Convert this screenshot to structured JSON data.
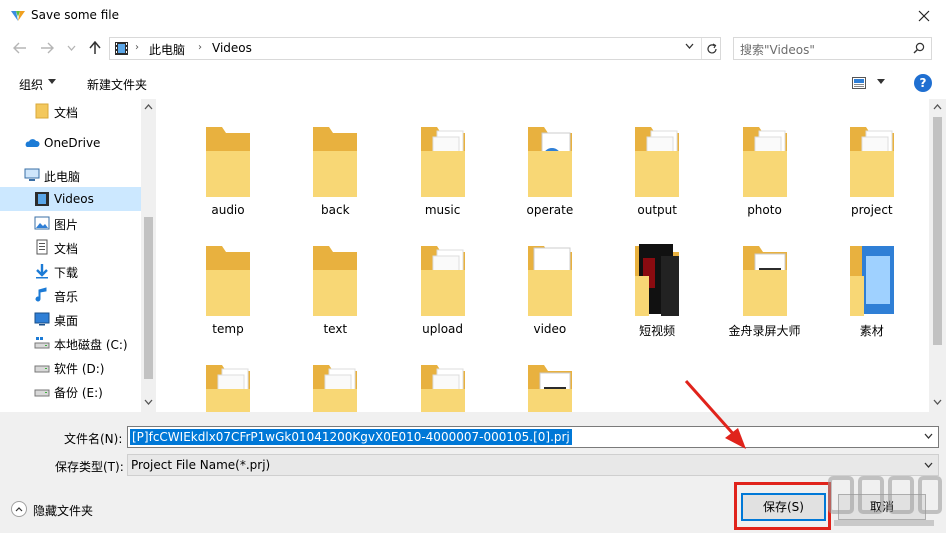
{
  "window": {
    "title": "Save some file"
  },
  "address": {
    "crumbs": [
      "此电脑",
      "Videos"
    ],
    "search_placeholder": "搜索\"Videos\""
  },
  "toolbar": {
    "organize": "组织",
    "new_folder": "新建文件夹",
    "help": "?"
  },
  "nav": {
    "items": [
      {
        "label": "文档",
        "icon": "folder-icon"
      },
      {
        "label": "OneDrive",
        "icon": "cloud-icon"
      },
      {
        "label": "此电脑",
        "icon": "computer-icon"
      },
      {
        "label": "Videos",
        "icon": "video-folder-icon",
        "selected": true
      },
      {
        "label": "图片",
        "icon": "pictures-icon"
      },
      {
        "label": "文档",
        "icon": "documents-icon"
      },
      {
        "label": "下载",
        "icon": "download-icon"
      },
      {
        "label": "音乐",
        "icon": "music-icon"
      },
      {
        "label": "桌面",
        "icon": "desktop-icon"
      },
      {
        "label": "本地磁盘 (C:)",
        "icon": "drive-c-icon"
      },
      {
        "label": "软件 (D:)",
        "icon": "drive-icon"
      },
      {
        "label": "备份 (E:)",
        "icon": "drive-icon"
      }
    ]
  },
  "files": [
    {
      "name": "audio",
      "kind": "empty"
    },
    {
      "name": "back",
      "kind": "empty"
    },
    {
      "name": "music",
      "kind": "doc"
    },
    {
      "name": "operate",
      "kind": "media"
    },
    {
      "name": "output",
      "kind": "doc"
    },
    {
      "name": "photo",
      "kind": "doc"
    },
    {
      "name": "project",
      "kind": "doc"
    },
    {
      "name": "temp",
      "kind": "empty"
    },
    {
      "name": "text",
      "kind": "empty"
    },
    {
      "name": "upload",
      "kind": "doc"
    },
    {
      "name": "video",
      "kind": "page"
    },
    {
      "name": "短视频",
      "kind": "dark"
    },
    {
      "name": "金舟录屏大师",
      "kind": "film"
    },
    {
      "name": "素材",
      "kind": "blue"
    },
    {
      "name": "",
      "kind": "doc"
    },
    {
      "name": "",
      "kind": "doc"
    },
    {
      "name": "",
      "kind": "doc"
    },
    {
      "name": "",
      "kind": "film"
    }
  ],
  "bottom": {
    "filename_label": "文件名(N):",
    "filename_value": "[P]fcCWIEkdlx07CFrP1wGk01041200KgvX0E010-4000007-000105.[0].prj",
    "filetype_label": "保存类型(T):",
    "filetype_value": "Project File Name(*.prj)",
    "hide_folders": "隐藏文件夹",
    "save": "保存(S)",
    "cancel": "取消"
  }
}
